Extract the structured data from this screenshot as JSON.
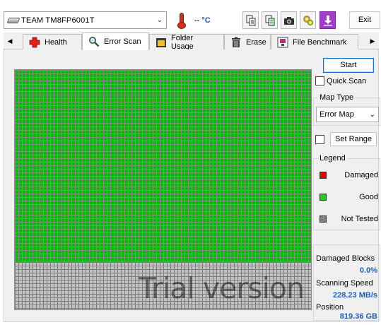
{
  "toolbar": {
    "drive_name": "TEAM TM8FP6001T",
    "temperature": "-- °C",
    "exit_label": "Exit"
  },
  "tabs": [
    {
      "label": "Health",
      "icon": "health-cross-icon"
    },
    {
      "label": "Error Scan",
      "icon": "magnifier-icon",
      "active": true
    },
    {
      "label": "Folder Usage",
      "icon": "folder-icon"
    },
    {
      "label": "Erase",
      "icon": "trash-icon"
    },
    {
      "label": "File Benchmark",
      "icon": "benchmark-icon"
    }
  ],
  "scan": {
    "start_label": "Start",
    "quick_scan_label": "Quick Scan",
    "map_type_title": "Map Type",
    "map_type_value": "Error Map",
    "set_range_label": "Set Range",
    "watermark": "Trial version"
  },
  "legend": {
    "title": "Legend",
    "items": [
      {
        "label": "Damaged",
        "color": "#e00000"
      },
      {
        "label": "Good",
        "color": "#22cc22"
      },
      {
        "label": "Not Tested",
        "color": "#808080"
      }
    ]
  },
  "stats": {
    "damaged_blocks_label": "Damaged Blocks",
    "damaged_blocks_value": "0.0%",
    "scanning_speed_label": "Scanning Speed",
    "scanning_speed_value": "228.23 MB/s",
    "position_label": "Position",
    "position_value": "819.36 GB"
  },
  "colors": {
    "good_block": "#10b410",
    "untested_block": "#c2c2c2",
    "accent": "#1f5fb5"
  }
}
